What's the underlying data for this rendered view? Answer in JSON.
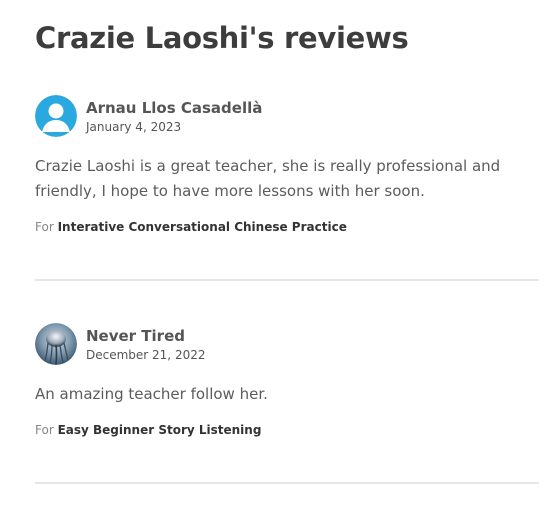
{
  "page": {
    "title": "Crazie Laoshi's reviews"
  },
  "reviews": [
    {
      "reviewer": "Arnau Llos Casadellà",
      "date": "January 4, 2023",
      "text": "Crazie Laoshi is a great teacher, she is really professional and friendly, I hope to have more lessons with her soon.",
      "course_prefix": "For",
      "course": "Interative Conversational Chinese Practice",
      "avatar_icon": "default-user-avatar-icon",
      "avatar_color": "#29a9e0"
    },
    {
      "reviewer": "Never Tired",
      "date": "December 21, 2022",
      "text": "An amazing teacher follow her.",
      "course_prefix": "For",
      "course": "Easy Beginner Story Listening",
      "avatar_icon": "jellyfish-photo-avatar",
      "avatar_color": "#4a6a88"
    }
  ],
  "colors": {
    "title": "#3d3d3d",
    "body_text": "#5c5c5c",
    "muted": "#888888",
    "divider": "#e6e6e6",
    "accent_avatar": "#29a9e0"
  }
}
